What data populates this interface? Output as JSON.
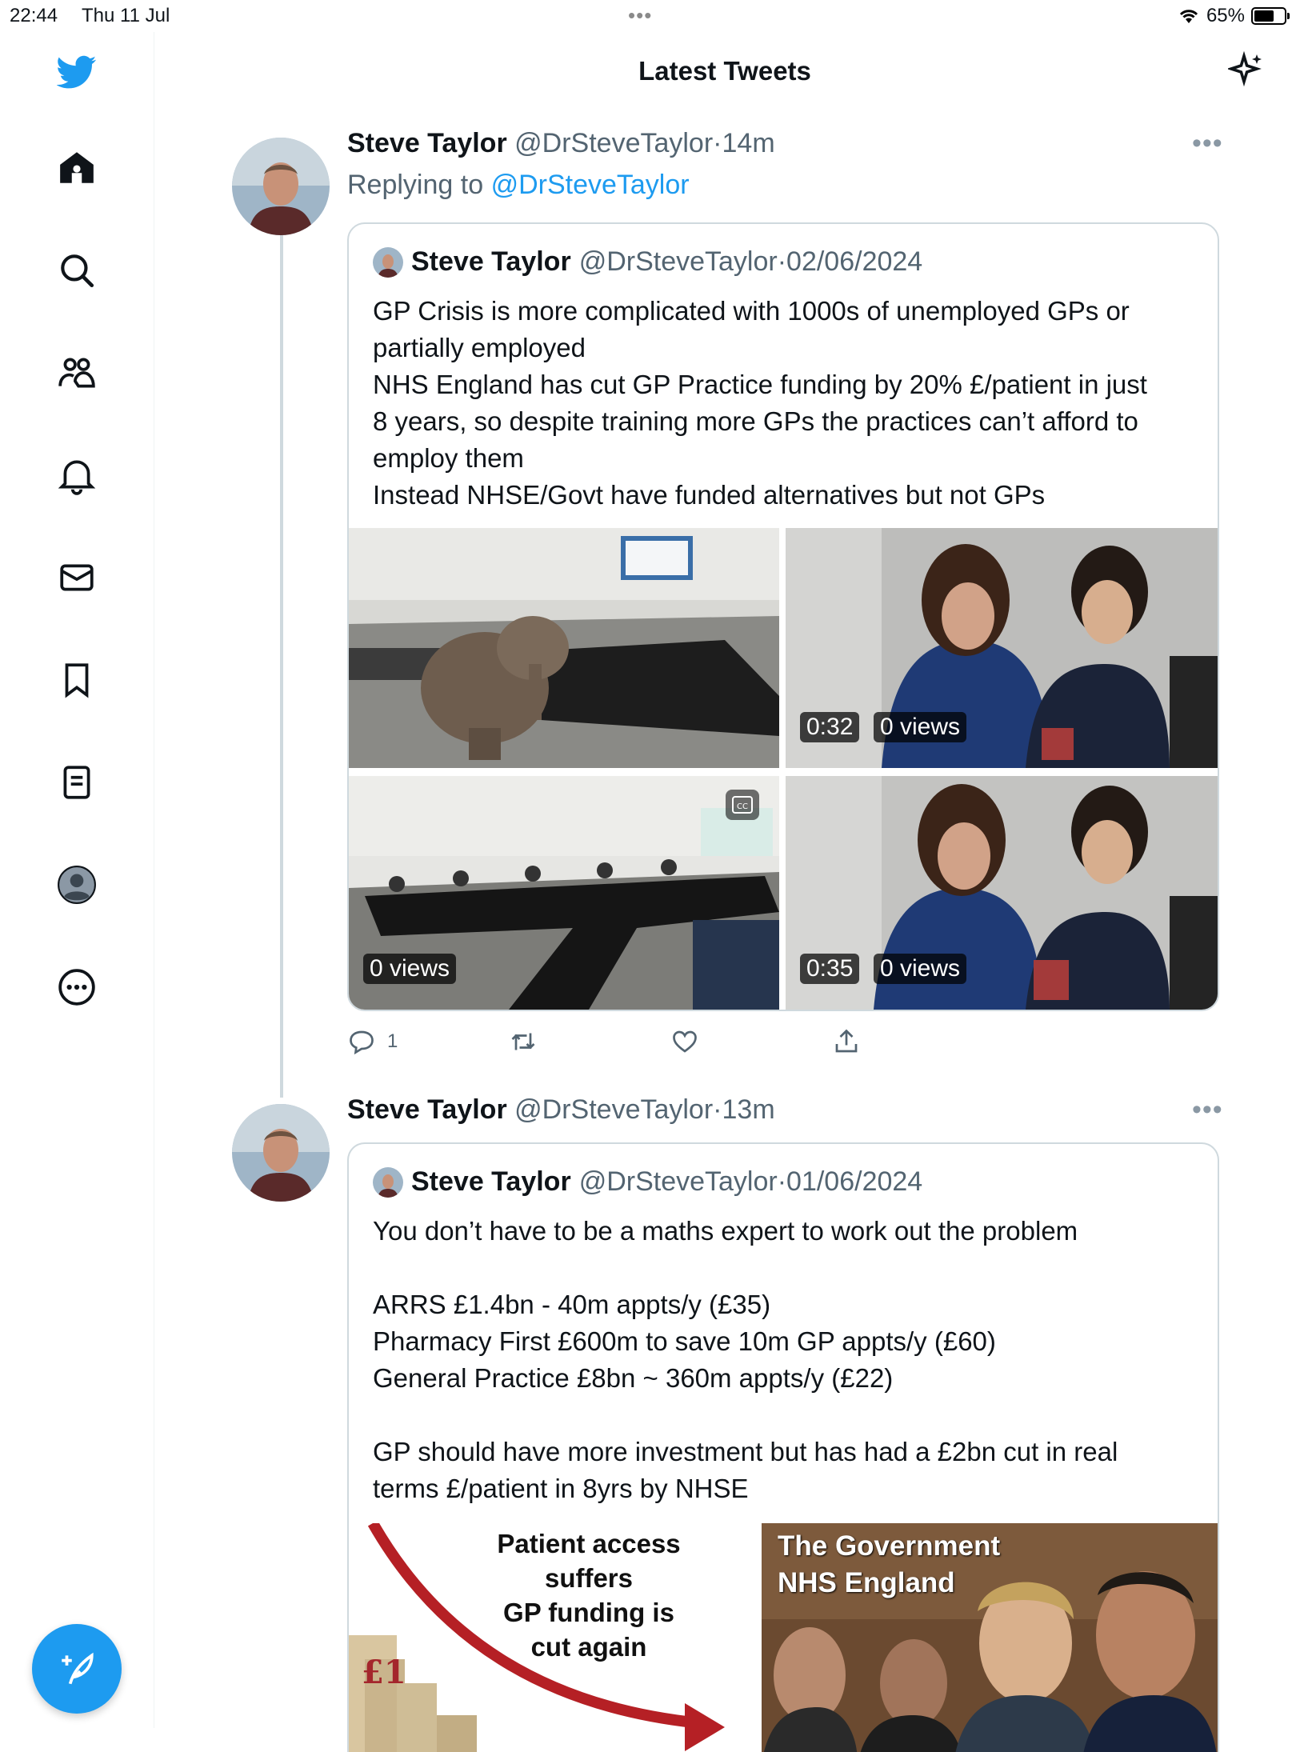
{
  "status_bar": {
    "time": "22:44",
    "date": "Thu 11 Jul",
    "battery": "65%"
  },
  "header": {
    "title": "Latest Tweets"
  },
  "nav": {
    "items": [
      "twitter-logo",
      "home-icon",
      "search-icon",
      "communities-icon",
      "notifications-icon",
      "messages-icon",
      "bookmarks-icon",
      "lists-icon",
      "profile-icon",
      "more-icon"
    ],
    "compose_label": "compose-tweet"
  },
  "tweets": [
    {
      "name": "Steve Taylor",
      "handle": "@DrSteveTaylor",
      "dot": "·",
      "time": "14m",
      "more": "•••",
      "replying_prefix": "Replying to",
      "replying_handle": "@DrSteveTaylor",
      "quote": {
        "name": "Steve Taylor",
        "handle": "@DrSteveTaylor",
        "dot": "·",
        "date": "02/06/2024",
        "lines": [
          "GP Crisis is more complicated with 1000s of unemployed GPs or",
          "partially employed",
          "NHS England has cut GP Practice funding by 20% £/patient in just",
          "8 years, so despite training more GPs the practices can’t afford to",
          "employ them",
          "Instead NHSE/Govt have funded alternatives but not GPs"
        ],
        "media": [
          {
            "duration": "",
            "views": ""
          },
          {
            "duration": "0:32",
            "views": "0 views"
          },
          {
            "duration": "",
            "views": "0 views"
          },
          {
            "duration": "0:35",
            "views": "0 views"
          }
        ]
      },
      "reply_count": "1"
    },
    {
      "name": "Steve Taylor",
      "handle": "@DrSteveTaylor",
      "dot": "·",
      "time": "13m",
      "more": "•••",
      "quote": {
        "name": "Steve Taylor",
        "handle": "@DrSteveTaylor",
        "dot": "·",
        "date": "01/06/2024",
        "lines": [
          "You don’t have to be a maths expert to work out the problem",
          "",
          "ARRS £1.4bn - 40m appts/y (£35)",
          "Pharmacy First £600m to save 10m GP appts/y (£60)",
          "General Practice £8bn ~ 360m appts/y (£22)",
          "",
          "GP should have more investment but has had a £2bn cut in real",
          "terms £/patient in 8yrs by NHSE"
        ],
        "image_left_text": [
          "Patient access",
          "suffers",
          "GP funding is",
          "cut again"
        ],
        "image_right_text": [
          "The Government",
          "NHS England"
        ]
      }
    }
  ]
}
